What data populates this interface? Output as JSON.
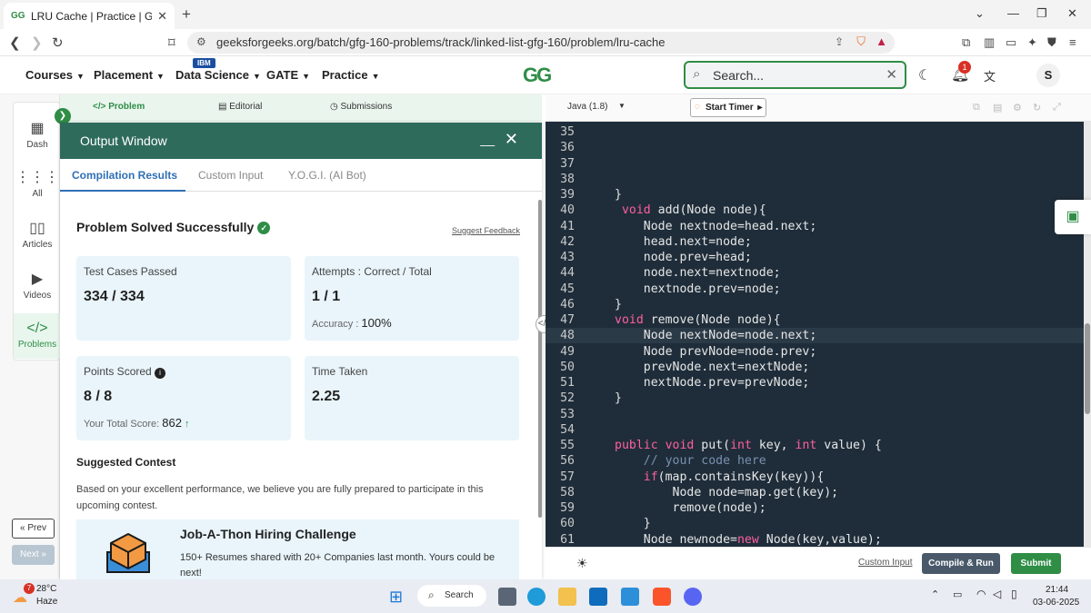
{
  "browser": {
    "tab_title": "LRU Cache | Practice | GeeksforG",
    "url": "geeksforgeeks.org/batch/gfg-160-problems/track/linked-list-gfg-160/problem/lru-cache"
  },
  "header": {
    "menu": [
      "Courses",
      "Placement",
      "Data Science",
      "GATE",
      "Practice"
    ],
    "ibm_badge": "IBM",
    "logo": "GG",
    "search_placeholder": "Search...",
    "notification_count": "1",
    "avatar_letter": "S"
  },
  "sidebar": {
    "items": [
      {
        "label": "Dash",
        "icon": "dashboard-icon"
      },
      {
        "label": "All",
        "icon": "grid-icon"
      },
      {
        "label": "Articles",
        "icon": "book-icon"
      },
      {
        "label": "Videos",
        "icon": "video-icon"
      },
      {
        "label": "Problems",
        "icon": "code-icon"
      }
    ],
    "prev_label": "« Prev",
    "next_label": "Next »"
  },
  "problem_tabs": [
    "Problem",
    "Editorial",
    "Submissions"
  ],
  "output": {
    "title": "Output Window",
    "tabs": [
      "Compilation Results",
      "Custom Input",
      "Y.O.G.I. (AI Bot)"
    ],
    "status": "Problem Solved Successfully",
    "feedback_link": "Suggest Feedback",
    "test_cases_label": "Test Cases Passed",
    "test_cases_value": "334 / 334",
    "attempts_label": "Attempts : Correct / Total",
    "attempts_value": "1 / 1",
    "accuracy_label": "Accuracy :",
    "accuracy_value": "100%",
    "points_label": "Points Scored",
    "points_value": "8 / 8",
    "total_score_label": "Your Total Score:",
    "total_score_value": "862",
    "time_label": "Time Taken",
    "time_value": "2.25",
    "suggested_title": "Suggested Contest",
    "suggested_text": "Based on your excellent performance, we believe you are fully prepared to participate in this upcoming contest.",
    "contest_title": "Job-A-Thon Hiring Challenge",
    "contest_desc": "150+ Resumes shared with 20+ Companies last month. Yours could be next!"
  },
  "editor": {
    "language": "Java (1.8)",
    "timer_label": "Start Timer",
    "lines": [
      {
        "n": "35",
        "code": ""
      },
      {
        "n": "36",
        "code": ""
      },
      {
        "n": "37",
        "code": ""
      },
      {
        "n": "38",
        "code": ""
      },
      {
        "n": "39",
        "code": "}"
      },
      {
        "n": "40",
        "code": " void add(Node node){"
      },
      {
        "n": "41",
        "code": "    Node nextnode=head.next;"
      },
      {
        "n": "42",
        "code": "    head.next=node;"
      },
      {
        "n": "43",
        "code": "    node.prev=head;"
      },
      {
        "n": "44",
        "code": "    node.next=nextnode;"
      },
      {
        "n": "45",
        "code": "    nextnode.prev=node;"
      },
      {
        "n": "46",
        "code": "}"
      },
      {
        "n": "47",
        "code": "void remove(Node node){"
      },
      {
        "n": "48",
        "code": "    Node nextNode=node.next;"
      },
      {
        "n": "49",
        "code": "    Node prevNode=node.prev;"
      },
      {
        "n": "50",
        "code": "    prevNode.next=nextNode;"
      },
      {
        "n": "51",
        "code": "    nextNode.prev=prevNode;"
      },
      {
        "n": "52",
        "code": "}"
      },
      {
        "n": "53",
        "code": ""
      },
      {
        "n": "54",
        "code": ""
      },
      {
        "n": "55",
        "code": "public void put(int key, int value) {"
      },
      {
        "n": "56",
        "code": "    // your code here"
      },
      {
        "n": "57",
        "code": "    if(map.containsKey(key)){"
      },
      {
        "n": "58",
        "code": "        Node node=map.get(key);"
      },
      {
        "n": "59",
        "code": "        remove(node);"
      },
      {
        "n": "60",
        "code": "    }"
      },
      {
        "n": "61",
        "code": "    Node newnode=new Node(key,value);"
      }
    ],
    "highlight_line": "48",
    "custom_input": "Custom Input",
    "compile_label": "Compile & Run",
    "submit_label": "Submit"
  },
  "taskbar": {
    "weather_temp": "28°C",
    "weather_cond": "Haze",
    "weather_badge": "7",
    "search_label": "Search",
    "time": "21:44",
    "date": "03-06-2025"
  },
  "colors": {
    "brand_green": "#2f8d46",
    "output_header": "#2e6b5b",
    "editor_bg": "#1f2d3a",
    "keyword": "#ff5fa0",
    "tab_active": "#2f6fb5"
  }
}
